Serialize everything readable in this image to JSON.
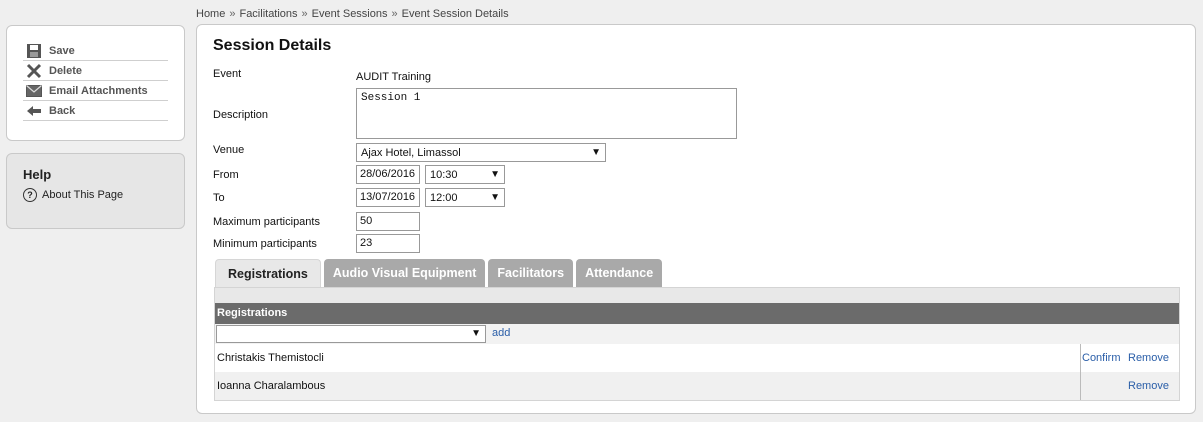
{
  "breadcrumb": [
    "Home",
    "Facilitations",
    "Event Sessions",
    "Event Session Details"
  ],
  "breadcrumb_separator": "»",
  "actions": {
    "save": "Save",
    "delete": "Delete",
    "email": "Email Attachments",
    "back": "Back"
  },
  "help": {
    "title": "Help",
    "about": "About This Page",
    "about_icon": "?"
  },
  "form": {
    "title": "Session Details",
    "event_label": "Event",
    "event_value": "AUDIT Training",
    "description_label": "Description",
    "description_value": "Session 1",
    "venue_label": "Venue",
    "venue_value": "Ajax Hotel, Limassol",
    "from_label": "From",
    "from_date": "28/06/2016",
    "from_time": "10:30",
    "to_label": "To",
    "to_date": "13/07/2016",
    "to_time": "12:00",
    "max_label": "Maximum participants",
    "max_value": "50",
    "min_label": "Minimum participants",
    "min_value": "23"
  },
  "tabs": [
    {
      "label": "Registrations",
      "active": true
    },
    {
      "label": "Audio Visual Equipment",
      "active": false
    },
    {
      "label": "Facilitators",
      "active": false
    },
    {
      "label": "Attendance",
      "active": false
    }
  ],
  "registrations": {
    "header": "Registrations",
    "add_label": "add",
    "rows": [
      {
        "name": "Christakis Themistocli",
        "confirm": "Confirm",
        "remove": "Remove"
      },
      {
        "name": "Ioanna Charalambous",
        "confirm": "",
        "remove": "Remove"
      }
    ]
  },
  "colors": {
    "link": "#2a5ea8",
    "table_header": "#6b6b6b",
    "inactive_tab": "#a9a9a9"
  }
}
